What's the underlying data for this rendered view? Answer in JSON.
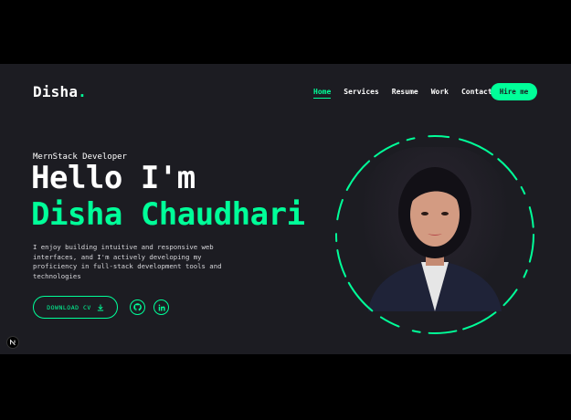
{
  "header": {
    "logo_text": "Disha",
    "logo_dot": ".",
    "nav": [
      {
        "label": "Home",
        "active": true
      },
      {
        "label": "Services",
        "active": false
      },
      {
        "label": "Resume",
        "active": false
      },
      {
        "label": "Work",
        "active": false
      },
      {
        "label": "Contact",
        "active": false
      }
    ],
    "hire_label": "Hire me"
  },
  "hero": {
    "role": "MernStack Developer",
    "greeting": "Hello I'm",
    "name": "Disha Chaudhari",
    "bio": "I enjoy building intuitive and responsive web interfaces, and I'm actively developing my proficiency in full-stack development tools and technologies",
    "download_label": "DOWNLOAD CV",
    "download_icon": "download-icon",
    "socials": [
      {
        "icon": "github-icon"
      },
      {
        "icon": "linkedin-icon"
      }
    ]
  },
  "colors": {
    "accent": "#00ff99",
    "background": "#1c1c22",
    "text": "#ffffff"
  }
}
